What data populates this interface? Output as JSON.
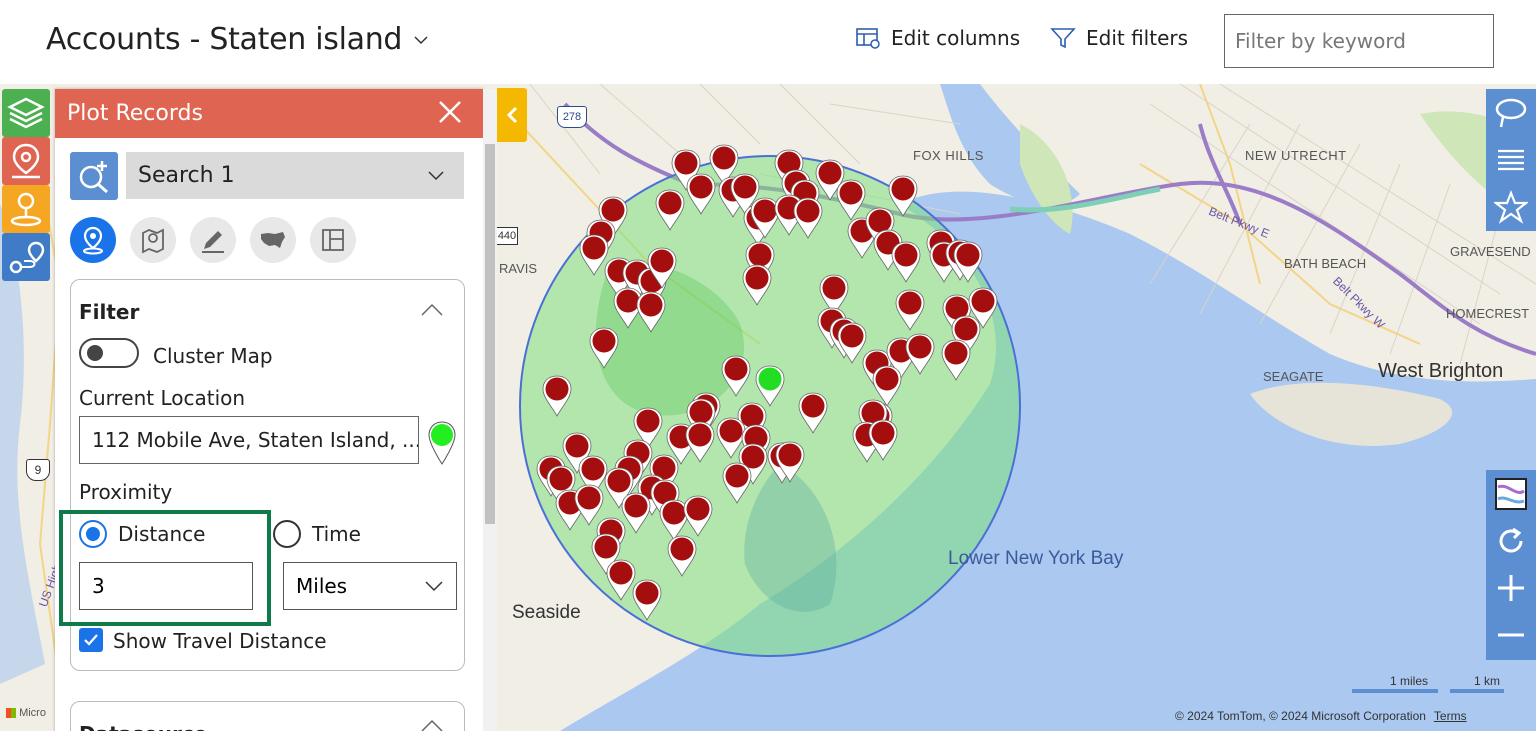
{
  "header": {
    "title": "Accounts - Staten island",
    "edit_columns": "Edit columns",
    "edit_filters": "Edit filters",
    "keyword_placeholder": "Filter by keyword"
  },
  "panel": {
    "title": "Plot Records",
    "search_value": "Search 1",
    "filter": {
      "heading": "Filter",
      "cluster_label": "Cluster Map",
      "current_location_label": "Current Location",
      "current_location_value": "112 Mobile Ave, Staten Island, ...",
      "proximity_label": "Proximity",
      "distance_label": "Distance",
      "time_label": "Time",
      "distance_value": "3",
      "units_value": "Miles",
      "show_travel_label": "Show Travel Distance"
    },
    "datasource_heading": "Datasource"
  },
  "map": {
    "labels": {
      "fox_hills": "FOX HILLS",
      "new_utrecht": "NEW UTRECHT",
      "gravesend": "GRAVESEND",
      "bath_beach": "BATH BEACH",
      "homecrest": "HOMECREST",
      "seagate": "SEAGATE",
      "west_brighton": "West Brighton",
      "travis": "RAVIS",
      "lower_ny_bay": "Lower New York Bay",
      "seaside": "Seaside",
      "belt_pkwy_e": "Belt Pkwy E",
      "belt_pkwy_w": "Belt Pkwy W",
      "route_278": "278",
      "route_440": "440",
      "route_9": "9",
      "us_highway": "US Highway 9 N",
      "micro": "Micro"
    },
    "scale_miles": "1 miles",
    "scale_km": "1 km",
    "copyright": "© 2024 TomTom, © 2024 Microsoft Corporation",
    "terms": "Terms"
  },
  "colors": {
    "panel_header": "#e06452",
    "accent": "#1a73e8",
    "toolbar": "#5b8fd1",
    "highlight": "#0f7a4a",
    "pin": "#a50e0e",
    "current_pin": "#22dd22",
    "radius_fill": "#7ee07e",
    "water": "#aac8f0"
  },
  "icons": [
    "layers-icon",
    "plot-records-icon",
    "territory-icon",
    "route-icon",
    "close-icon",
    "search-add-icon",
    "chevron-down-icon",
    "pin-mode-icon",
    "map-pin-mode-icon",
    "draw-icon",
    "usa-icon",
    "table-icon",
    "chevron-up-icon",
    "green-pin-icon",
    "checkmark-icon",
    "collapse-left-icon",
    "lasso-icon",
    "list-icon",
    "star-icon",
    "map-style-icon",
    "refresh-icon",
    "zoom-in-icon",
    "zoom-out-icon",
    "edit-columns-icon",
    "filter-icon"
  ]
}
